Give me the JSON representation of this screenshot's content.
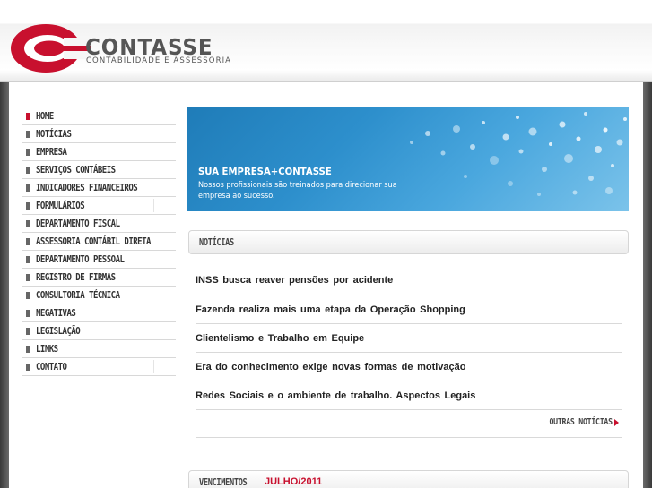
{
  "brand": {
    "name": "CONTASSE",
    "tagline": "CONTABILIDADE E ASSESSORIA",
    "logo_color": "#c8102e"
  },
  "menu": {
    "items": [
      {
        "label": "HOME",
        "active": true
      },
      {
        "label": "NOTÍCIAS"
      },
      {
        "label": "EMPRESA"
      },
      {
        "label": "SERVIÇOS CONTÁBEIS"
      },
      {
        "label": "INDICADORES FINANCEIROS"
      },
      {
        "label": "FORMULÁRIOS"
      },
      {
        "label": "DEPARTAMENTO FISCAL"
      },
      {
        "label": "ASSESSORIA CONTÁBIL DIRETA"
      },
      {
        "label": "DEPARTAMENTO PESSOAL"
      },
      {
        "label": "REGISTRO DE FIRMAS"
      },
      {
        "label": "CONSULTORIA TÉCNICA"
      },
      {
        "label": "NEGATIVAS"
      },
      {
        "label": "LEGISLAÇÃO"
      },
      {
        "label": "LINKS"
      },
      {
        "label": "CONTATO"
      }
    ]
  },
  "banner": {
    "title": "SUA EMPRESA+CONTASSE",
    "text": "Nossos profissionais são treinados para direcionar sua empresa ao sucesso."
  },
  "news": {
    "heading": "NOTÍCIAS",
    "items": [
      "INSS busca reaver pensões por acidente",
      "Fazenda realiza mais uma etapa da Operação Shopping",
      "Clientelismo e Trabalho em Equipe",
      "Era do conhecimento exige novas formas de motivação",
      "Redes Sociais e o ambiente de trabalho. Aspectos Legais"
    ],
    "more_label": "OUTRAS NOTÍCIAS"
  },
  "vencimentos": {
    "heading": "VENCIMENTOS",
    "month": "JULHO/2011"
  }
}
